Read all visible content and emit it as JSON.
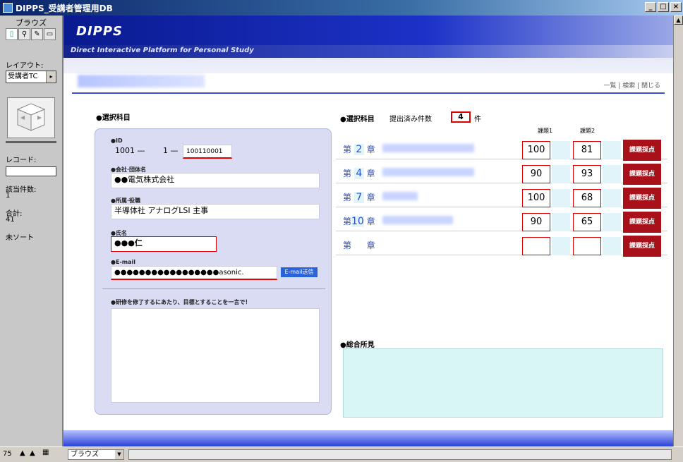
{
  "window": {
    "title": "DIPPS_受講者管理用DB",
    "minimize": "_",
    "maximize": "□",
    "close": "×"
  },
  "left_panel": {
    "mode": "ブラウズ",
    "layout_label": "レイアウト:",
    "layout_value": "受講者TC",
    "record_label": "レコード:",
    "record_value": "",
    "found_label": "該当件数:",
    "found_value": "1",
    "total_label": "合計:",
    "total_value": "41",
    "sort_label": "未ソート"
  },
  "header": {
    "brand": "DIPPS",
    "subtitle": "Direct Interactive Platform for Personal Study",
    "top_links": "一覧 | 検索 | 閉じる"
  },
  "left_section": {
    "heading": "●選択科目",
    "id_label": "●ID",
    "id_part1": "1001 —",
    "id_part2": "1 —",
    "id_part3": "100110001",
    "company_label": "●会社·団体名",
    "company_value": "●●電気株式会社",
    "dept_label": "●所属·役職",
    "dept_value": "半導体社 アナログLSI 主事",
    "name_label": "●氏名",
    "name_value": "●●●仁",
    "email_label": "●E-mail",
    "email_value": "●●●●●●●●●●●●●●●●●asonic.",
    "email_button": "E-mail送信",
    "comment_label": "●研修を修了するにあたり、目標とすることを一言で！"
  },
  "right_section": {
    "heading": "●選択科目",
    "submitted_label": "提出済み件数",
    "submitted_count": "4",
    "submitted_unit": "件",
    "col1": "課題1",
    "col2": "課題2",
    "rows": [
      {
        "prefix": "第",
        "chapter": "2",
        "suffix": "章",
        "score1": "100",
        "score2": "81",
        "button": "課題採点"
      },
      {
        "prefix": "第",
        "chapter": "4",
        "suffix": "章",
        "score1": "90",
        "score2": "93",
        "button": "課題採点"
      },
      {
        "prefix": "第",
        "chapter": "7",
        "suffix": "章",
        "score1": "100",
        "score2": "68",
        "button": "課題採点"
      },
      {
        "prefix": "第",
        "chapter": "10",
        "suffix": "章",
        "score1": "90",
        "score2": "65",
        "button": "課題採点"
      },
      {
        "prefix": "第",
        "chapter": "",
        "suffix": "章",
        "score1": "",
        "score2": "",
        "button": "課題採点"
      }
    ],
    "overall_label": "●総合所見"
  },
  "status_bar": {
    "zoom": "75",
    "mode": "ブラウズ"
  },
  "colors": {
    "brand_blue": "#1c32c8",
    "accent_red": "#a8111a",
    "comment_bg": "#d8f6f6"
  }
}
